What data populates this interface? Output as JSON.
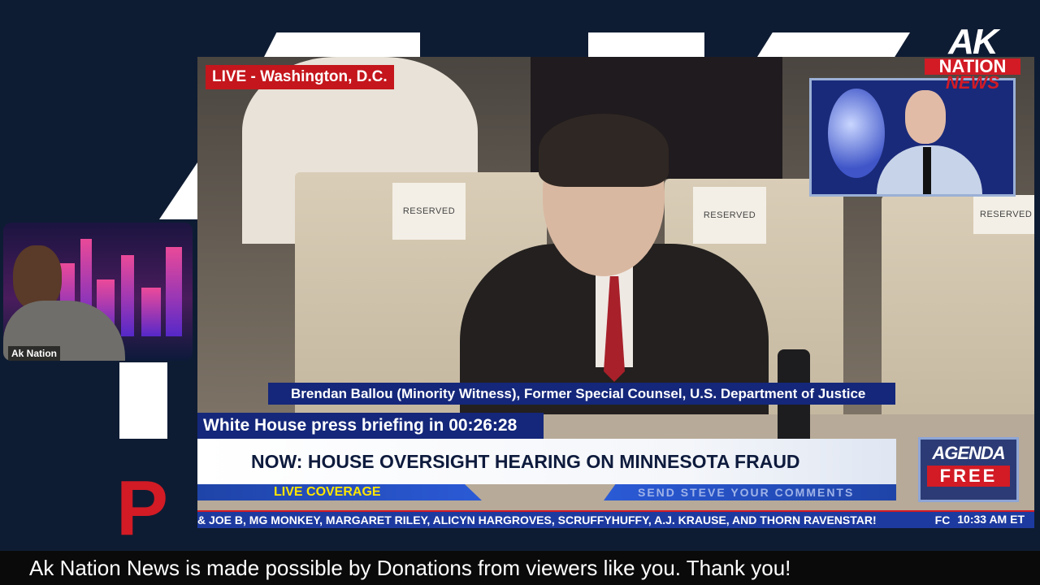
{
  "video": {
    "live_tag": "LIVE - Washington, D.C.",
    "placard_text": "RESERVED",
    "witness_label": "Brendan Ballou (Minority Witness), Former Special Counsel, U.S. Department of Justice",
    "briefing_countdown": "White House press briefing in 00:26:28",
    "headline": "NOW: HOUSE OVERSIGHT HEARING ON MINNESOTA FRAUD",
    "live_coverage": "LIVE COVERAGE",
    "send_comments": "SEND STEVE YOUR COMMENTS",
    "ticker": "& JOE B, MG MONKEY, MARGARET RILEY, ALICYN HARGROVES, SCRUFFYHUFFY, A.J. KRAUSE, AND THORN RAVENSTAR!",
    "ticker_tail": "FC",
    "clock": "10:33 AM ET",
    "agenda_top": "AGENDA",
    "agenda_bottom": "FREE"
  },
  "logo": {
    "ak": "AK",
    "nation": "NATION",
    "news": "NEWS"
  },
  "webcam": {
    "label": "Ak Nation"
  },
  "background_letter": "P",
  "footer": {
    "message": "Ak Nation News is made possible by Donations from viewers like you. Thank you!"
  },
  "colors": {
    "background": "#0e1c33",
    "accent_red": "#d21b25",
    "bar_blue": "#14277a"
  }
}
